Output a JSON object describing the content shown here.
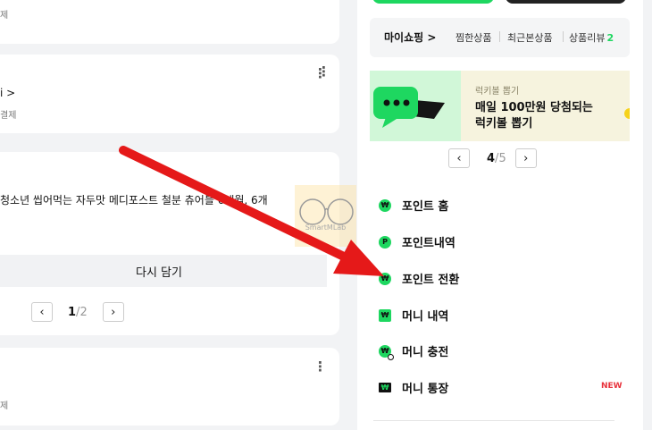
{
  "left": {
    "card1": {
      "caption": "제"
    },
    "card2": {
      "title": "i >",
      "caption": "결제"
    },
    "card3": {
      "product": "청소년 씹어먹는 자두맛 메디포스트 철분 츄어블 6개월, 6개",
      "rebuy_label": "다시 담기",
      "page_current": "1",
      "page_sep": "/",
      "page_total": "2",
      "prev": "‹",
      "next": "›"
    },
    "card4": {
      "caption": "제"
    },
    "more": "⋮"
  },
  "watermark": {
    "text": "SmartMLab"
  },
  "right": {
    "my_shopping": "마이쇼핑 >",
    "tabs": [
      {
        "label": "찜한상품"
      },
      {
        "label": "최근본상품"
      },
      {
        "label": "상품리뷰",
        "count": "2"
      }
    ],
    "banner": {
      "eyebrow": "럭키볼 뽑기",
      "line1": "매일 100만원 당첨되는",
      "line2": "럭키볼 뽑기",
      "page_current": "4",
      "page_sep": "/",
      "page_total": "5",
      "prev": "‹",
      "next": "›"
    },
    "menu": [
      {
        "label": "포인트 홈",
        "icon": "point-home-icon",
        "glyph": "₩"
      },
      {
        "label": "포인트내역",
        "icon": "point-history-icon",
        "glyph": "P"
      },
      {
        "label": "포인트 전환",
        "icon": "point-convert-icon",
        "glyph": "₩"
      },
      {
        "label": "머니 내역",
        "icon": "money-history-icon",
        "glyph": "₩"
      },
      {
        "label": "머니 충전",
        "icon": "money-charge-icon",
        "glyph": "₩"
      },
      {
        "label": "머니 통장",
        "icon": "money-account-icon",
        "glyph": "₩",
        "badge": "NEW"
      }
    ]
  },
  "colors": {
    "accent_green": "#1ed760",
    "new_red": "#e8323c",
    "banner_bg": "#f6f3de",
    "arrow_red": "#e51919"
  }
}
